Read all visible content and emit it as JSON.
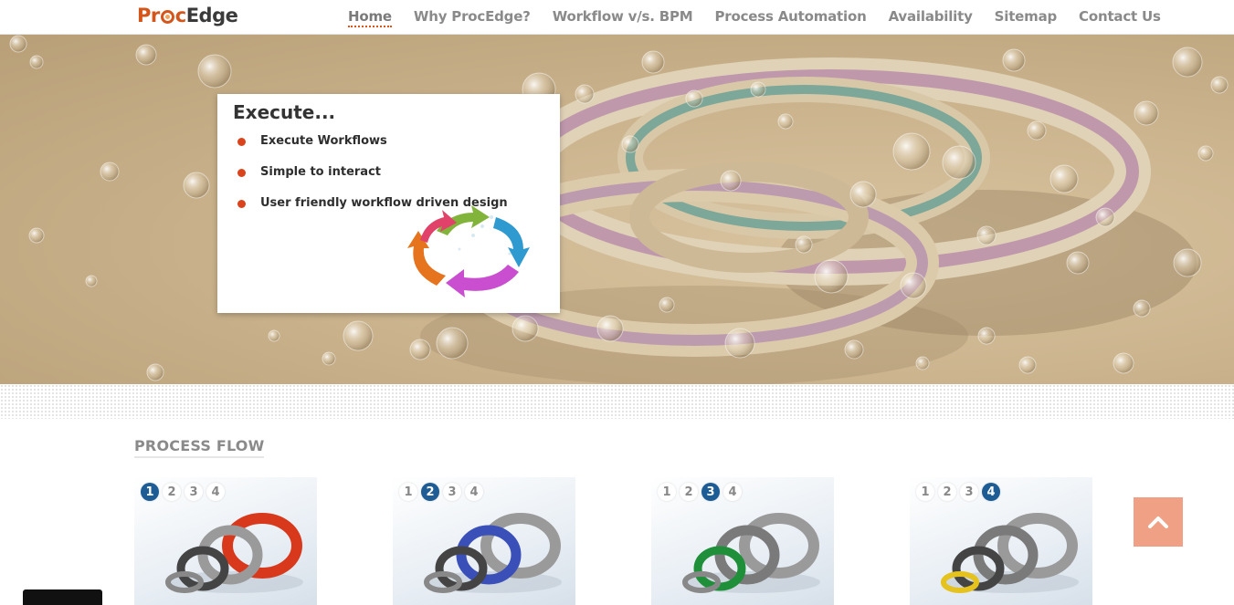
{
  "header": {
    "logo": {
      "part1": "Pr",
      "part2": "c",
      "part3": "Edge"
    },
    "nav": [
      {
        "label": "Home",
        "active": true
      },
      {
        "label": "Why ProcEdge?"
      },
      {
        "label": "Workflow v/s. BPM"
      },
      {
        "label": "Process Automation"
      },
      {
        "label": "Availability"
      },
      {
        "label": "Sitemap"
      },
      {
        "label": "Contact Us"
      }
    ]
  },
  "hero": {
    "title": "Execute...",
    "bullets": [
      "Execute Workflows",
      "Simple to interact",
      "User friendly workflow driven design"
    ]
  },
  "process_flow": {
    "title": "PROCESS FLOW",
    "steps": [
      "1",
      "2",
      "3",
      "4"
    ],
    "cards": [
      {
        "active_step": 1,
        "accent": "#d8391d"
      },
      {
        "active_step": 2,
        "accent": "#3a4fb8"
      },
      {
        "active_step": 3,
        "accent": "#1f8f3a"
      },
      {
        "active_step": 4,
        "accent": "#e5c21e"
      }
    ]
  },
  "scroll_top": {
    "icon": "chevron-up-icon"
  },
  "colors": {
    "brand": "#d4561b",
    "active_step": "#1d5c95",
    "scroll_top": "#f0a084"
  }
}
